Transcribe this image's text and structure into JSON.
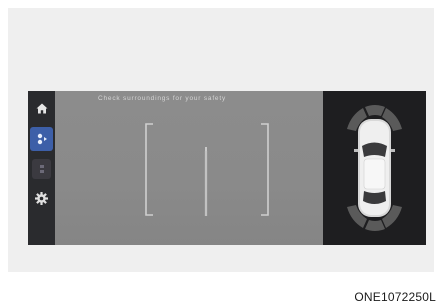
{
  "screen": {
    "caution_text": "Check surroundings for your safety",
    "sidebar": {
      "items": [
        {
          "name": "home",
          "icon": "home-icon",
          "active": false
        },
        {
          "name": "rear-camera-view",
          "icon": "camera-view-icon",
          "active": true
        },
        {
          "name": "camera-option",
          "icon": "camera-option-icon",
          "active": false
        },
        {
          "name": "settings",
          "icon": "gear-icon",
          "active": false
        }
      ]
    },
    "sensor_zones": {
      "front_left": "active",
      "front_center": "active",
      "front_right": "active",
      "rear_left": "active",
      "rear_center": "active",
      "rear_right": "active"
    }
  },
  "figure_code": "ONE1072250L",
  "colors": {
    "active_button": "#3d5fa8",
    "sensor_arc": "#5a5a5a",
    "guide_line": "#cfcfcf"
  }
}
